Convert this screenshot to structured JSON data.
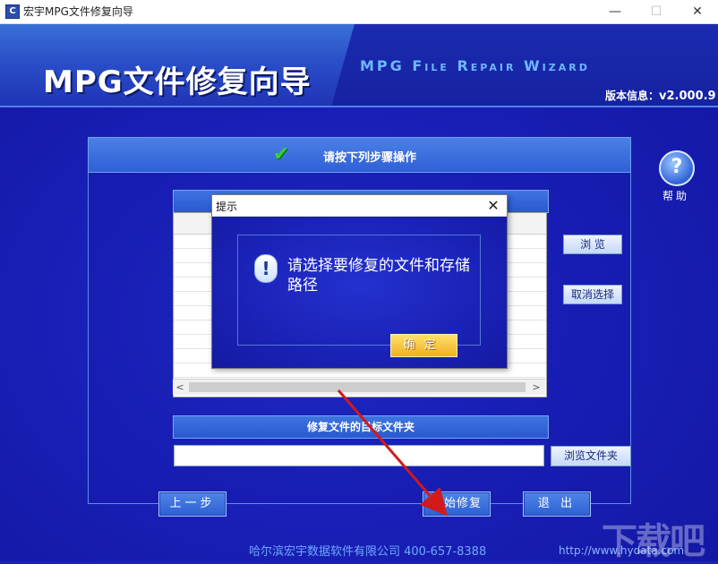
{
  "window": {
    "title": "宏宇MPG文件修复向导",
    "minimize": "—",
    "maximize": "☐",
    "close": "✕"
  },
  "banner": {
    "title": "MPG文件修复向导",
    "subtitle_en": "MPG File Repair Wizard",
    "version_label": "版本信息：",
    "version_value": "v2.000.9"
  },
  "panel": {
    "title": "请按下列步骤操作",
    "check_icon": "check-icon"
  },
  "help": {
    "icon": "?",
    "label": "帮助"
  },
  "side_buttons": {
    "browse": "浏 览",
    "cancel_select": "取消选择",
    "browse_folder": "浏览文件夹"
  },
  "target": {
    "header": "修复文件的目标文件夹",
    "path_value": ""
  },
  "nav": {
    "prev": "上一步",
    "start": "开始修复",
    "exit": "退 出"
  },
  "footer": {
    "company": "哈尔滨宏宇数据软件有限公司  400-657-8388",
    "url": "http://www.hydata.com"
  },
  "watermark": "下载吧",
  "dialog": {
    "title": "提示",
    "close": "✕",
    "message": "请选择要修复的文件和存储路径",
    "ok": "确定",
    "icon": "!"
  },
  "colors": {
    "background": "#1c22b8",
    "accent": "#2f60d6",
    "arrow": "#d21a1a",
    "ok_button": "#f0b020"
  }
}
